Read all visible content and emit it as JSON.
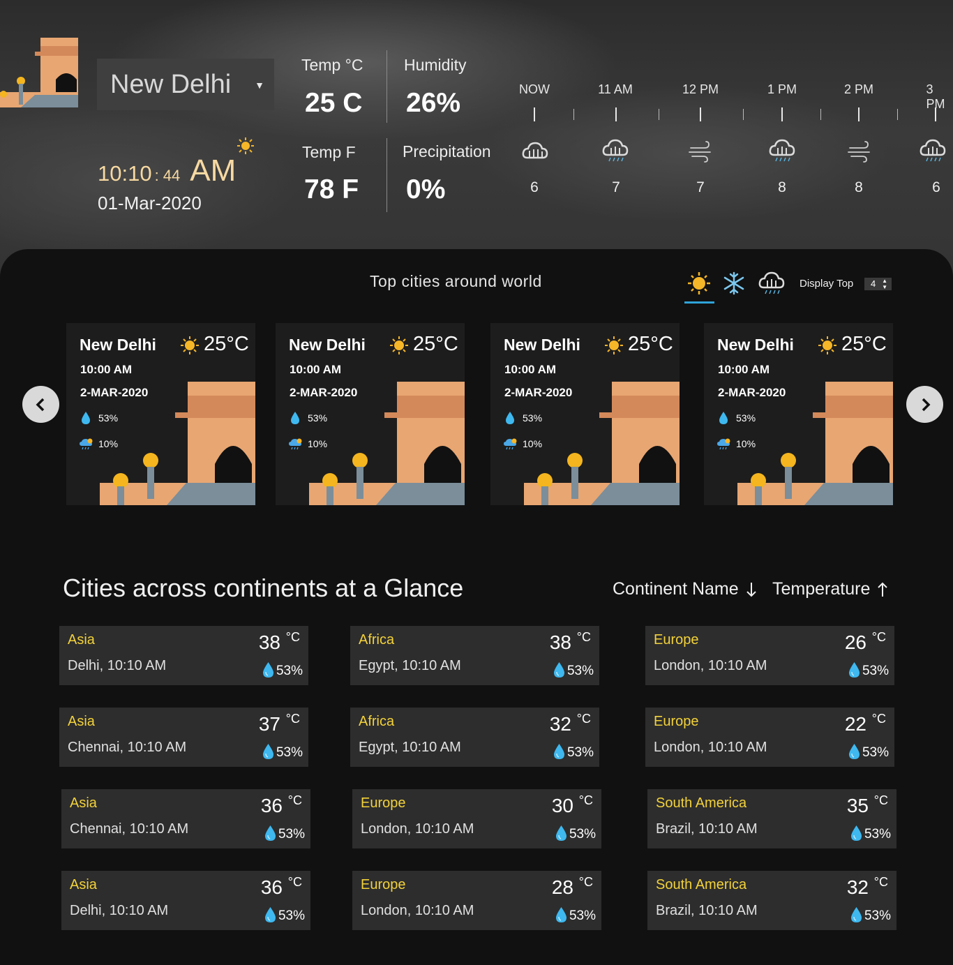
{
  "header": {
    "city": "New Delhi",
    "time_hm": "10:10",
    "time_sec": ": 44",
    "time_ampm": "AM",
    "date": "01-Mar-2020",
    "temp_c_label": "Temp °C",
    "temp_c_value": "25 C",
    "temp_f_label": "Temp F",
    "temp_f_value": "78 F",
    "humidity_label": "Humidity",
    "humidity_value": "26%",
    "precip_label": "Precipitation",
    "precip_value": "0%"
  },
  "hourly": [
    {
      "label": "NOW",
      "icon": "rainy-cloud-icon",
      "value": "6"
    },
    {
      "label": "11 AM",
      "icon": "rain-cloud-icon",
      "value": "7"
    },
    {
      "label": "12 PM",
      "icon": "windy-icon",
      "value": "7"
    },
    {
      "label": "1 PM",
      "icon": "rain-cloud-icon",
      "value": "8"
    },
    {
      "label": "2 PM",
      "icon": "windy-icon",
      "value": "8"
    },
    {
      "label": "3 PM",
      "icon": "rain-cloud-icon",
      "value": "6"
    }
  ],
  "top_cities": {
    "title": "Top cities around world",
    "filters": [
      "sunny-icon",
      "snowflake-icon",
      "rainy-icon"
    ],
    "display_top_label": "Display Top",
    "display_top_value": "4",
    "cards": [
      {
        "city": "New Delhi",
        "temp": "25°C",
        "time": "10:00 AM",
        "date": "2-MAR-2020",
        "humidity": "53%",
        "precipitation": "10%"
      },
      {
        "city": "New Delhi",
        "temp": "25°C",
        "time": "10:00 AM",
        "date": "2-MAR-2020",
        "humidity": "53%",
        "precipitation": "10%"
      },
      {
        "city": "New Delhi",
        "temp": "25°C",
        "time": "10:00 AM",
        "date": "2-MAR-2020",
        "humidity": "53%",
        "precipitation": "10%"
      },
      {
        "city": "New Delhi",
        "temp": "25°C",
        "time": "10:00 AM",
        "date": "2-MAR-2020",
        "humidity": "53%",
        "precipitation": "10%"
      }
    ]
  },
  "continents": {
    "title": "Cities across continents at a Glance",
    "sort_continent": "Continent Name",
    "sort_temperature": "Temperature",
    "tiles": [
      {
        "continent": "Asia",
        "place": "Delhi, 10:10 AM",
        "temp": "38",
        "unit": "°C",
        "humidity": "53%"
      },
      {
        "continent": "Africa",
        "place": "Egypt, 10:10 AM",
        "temp": "38",
        "unit": "°C",
        "humidity": "53%"
      },
      {
        "continent": "Europe",
        "place": "London, 10:10 AM",
        "temp": "26",
        "unit": "°C",
        "humidity": "53%"
      },
      {
        "continent": "Asia",
        "place": "Chennai, 10:10 AM",
        "temp": "37",
        "unit": "°C",
        "humidity": "53%"
      },
      {
        "continent": "Africa",
        "place": "Egypt, 10:10 AM",
        "temp": "32",
        "unit": "°C",
        "humidity": "53%"
      },
      {
        "continent": "Europe",
        "place": "London, 10:10 AM",
        "temp": "22",
        "unit": "°C",
        "humidity": "53%"
      },
      {
        "continent": "Asia",
        "place": "Chennai, 10:10 AM",
        "temp": "36",
        "unit": "°C",
        "humidity": "53%"
      },
      {
        "continent": "Europe",
        "place": "London, 10:10 AM",
        "temp": "30",
        "unit": "°C",
        "humidity": "53%"
      },
      {
        "continent": "South America",
        "place": "Brazil, 10:10 AM",
        "temp": "35",
        "unit": "°C",
        "humidity": "53%"
      },
      {
        "continent": "Asia",
        "place": "Delhi, 10:10 AM",
        "temp": "36",
        "unit": "°C",
        "humidity": "53%"
      },
      {
        "continent": "Europe",
        "place": "London, 10:10 AM",
        "temp": "28",
        "unit": "°C",
        "humidity": "53%"
      },
      {
        "continent": "South America",
        "place": "Brazil, 10:10 AM",
        "temp": "32",
        "unit": "°C",
        "humidity": "53%"
      }
    ]
  },
  "colors": {
    "accent": "#2fa3d9",
    "continent_label": "#f3d23a",
    "time_text": "#f7d9a2",
    "monument": "#e8a672"
  }
}
